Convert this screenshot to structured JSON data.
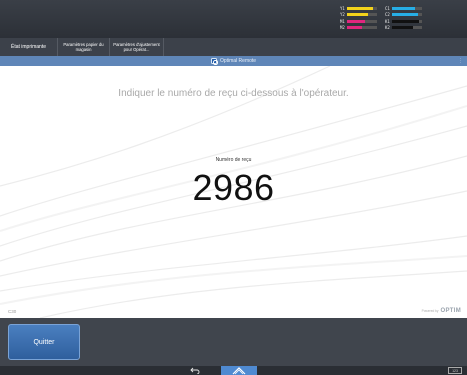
{
  "toner": {
    "rows": [
      {
        "left": {
          "label": "Y1",
          "color": "#f2d21b",
          "level": 0.85
        },
        "right": {
          "label": "C1",
          "color": "#27aee6",
          "level": 0.75
        }
      },
      {
        "left": {
          "label": "Y2",
          "color": "#f2d21b",
          "level": 0.7
        },
        "right": {
          "label": "C2",
          "color": "#27aee6",
          "level": 0.85
        }
      },
      {
        "left": {
          "label": "M1",
          "color": "#e0267e",
          "level": 0.6
        },
        "right": {
          "label": "K1",
          "color": "#111111",
          "level": 0.9
        }
      },
      {
        "left": {
          "label": "M2",
          "color": "#e0267e",
          "level": 0.5
        },
        "right": {
          "label": "K2",
          "color": "#111111",
          "level": 0.7
        }
      }
    ]
  },
  "tabs": [
    {
      "label": "État imprimante"
    },
    {
      "label": "Paramètres papier du magasin"
    },
    {
      "label": "Paramètres d'ajustement pour Opérat..."
    }
  ],
  "app": {
    "title": "Optimal Remote",
    "instruction": "Indiquer le numéro de reçu ci-dessous à l'opérateur.",
    "receipt_label": "Numéro de reçu",
    "receipt_number": "2986",
    "footer_code": "C30",
    "powered_by": "Powered by",
    "powered_logo": "OPTIM"
  },
  "buttons": {
    "quit": "Quitter"
  },
  "system": {
    "keyboard_label": "123"
  },
  "colors": {
    "accent": "#4f8ad1",
    "title_bar": "#5f86b8",
    "quit_button": "#3a6eb0"
  }
}
